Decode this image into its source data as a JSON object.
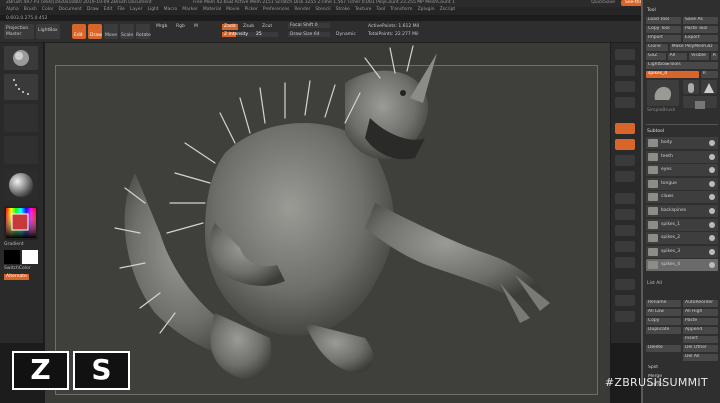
{
  "titlebar": {
    "title": "ZBrush 4R7 P3 (x64)(1920x1080) 2019-10-09 ZBrush Document",
    "info": "Free Mem 42.6GB  Active Mem 2151  Scratch Disk 3255  ZTime 1.567  Timer 0.001  PolyCount 23.255 MP  MeshCount 1",
    "quicksave": "QuickSave",
    "see_through": "See-through",
    "menus_label": "Menus",
    "default_script": "DefaultZScript"
  },
  "menubar": [
    "Alpha",
    "Brush",
    "Color",
    "Document",
    "Draw",
    "Edit",
    "File",
    "Layer",
    "Light",
    "Macro",
    "Marker",
    "Material",
    "Movie",
    "Picker",
    "Preferences",
    "Render",
    "Stencil",
    "Stroke",
    "Texture",
    "Tool",
    "Transform",
    "Zplugin",
    "Zscript"
  ],
  "coord": "0.603,0.275,0.452",
  "topshelf": {
    "projection_master": "Projection Master",
    "lightbox": "LightBox",
    "edit": "Edit",
    "draw": "Draw",
    "move": "Move",
    "scale": "Scale",
    "rotate": "Rotate",
    "mrgb": "Mrgb",
    "rgb": "Rgb",
    "m": "M",
    "zadd": "Zadd",
    "zsub": "Zsub",
    "zcut": "Zcut",
    "z_intensity_label": "Z Intensity",
    "z_intensity_value": "25",
    "z_intensity": 0.25,
    "focal_shift": "Focal Shift 0",
    "draw_size": "Draw Size 64",
    "dynamic": "Dynamic",
    "active_points": "ActivePoints: 1.612 Mil",
    "total_points": "TotalPoints: 22.277 Mil"
  },
  "leftshelf": {
    "gradient": "Gradient",
    "switch_color": "SwitchColor",
    "alternate": "Alternate"
  },
  "tray": {
    "header": "Tool",
    "rows": [
      [
        "Load Tool",
        "Save As"
      ],
      [
        "Copy Tool",
        "Paste Tool"
      ],
      [
        "Import",
        "Export"
      ],
      [
        "Clone",
        "Make PolyMesh3D"
      ],
      [
        "GoZ",
        "All",
        "Visible",
        "R"
      ],
      [
        "Lightbox▸Tools"
      ],
      [
        "spikes_4",
        "R"
      ]
    ],
    "thumb_labels": [
      "spikes_4",
      "Cylinder3D",
      "PolyMesh3D",
      "SimpleBrush"
    ],
    "subtool_header": "Subtool",
    "subtools": [
      "body",
      "teeth",
      "eyes",
      "tongue",
      "claws",
      "backspines",
      "spikes_1",
      "spikes_2",
      "spikes_3",
      "spikes_4"
    ],
    "list_all": "List All",
    "ops": [
      [
        "Rename",
        "AutoReorder"
      ],
      [
        "All Low",
        "All High"
      ],
      [
        "Copy",
        "Paste"
      ],
      [
        "Duplicate",
        "Append"
      ],
      [
        "",
        "Insert"
      ],
      [
        "Delete",
        "Del Other"
      ],
      [
        "",
        "Del All"
      ],
      [
        "Split"
      ],
      [
        "Merge"
      ],
      [
        "Extract"
      ]
    ]
  },
  "watermark": "#ZBRUSHSUMMIT",
  "logo": [
    "Z",
    "S"
  ],
  "colors": {
    "accent": "#d8662a",
    "panel": "#2f2f2f",
    "viewport": "#3a3a37"
  }
}
